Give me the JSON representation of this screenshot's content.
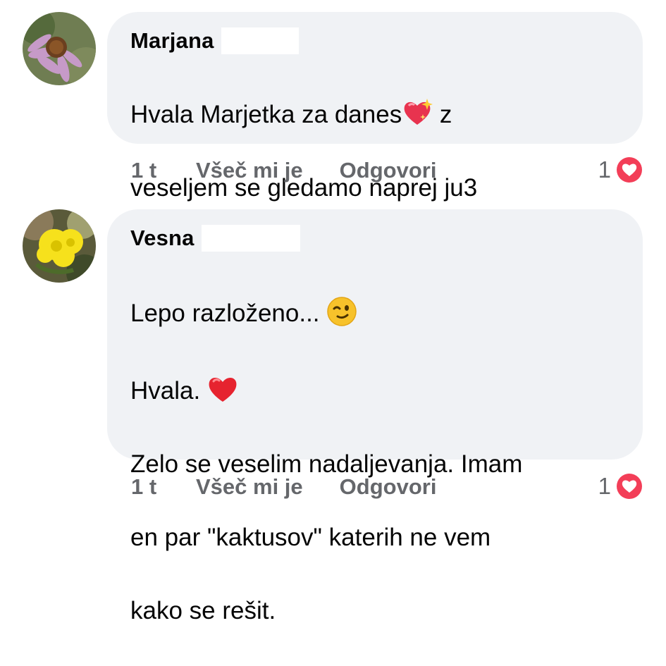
{
  "comments": [
    {
      "author": "Marjana",
      "lines": [
        "Hvala Marjetka za danes",
        " z",
        "veseljem se gledamo naprej ju3"
      ],
      "emoji_1": "sparkling-heart",
      "time": "1 t",
      "like_label": "Všeč mi je",
      "reply_label": "Odgovori",
      "reaction_count": "1",
      "reaction_type": "love"
    },
    {
      "author": "Vesna",
      "lines": [
        "Lepo razloženo... ",
        "Hvala. ",
        "Zelo se veselim nadaljevanja. Imam",
        "en par \"kaktusov\" katerih ne vem",
        "kako se rešit."
      ],
      "emoji_1": "winking-face",
      "emoji_2": "red-heart",
      "time": "1 t",
      "like_label": "Všeč mi je",
      "reply_label": "Odgovori",
      "reaction_count": "1",
      "reaction_type": "love"
    }
  ],
  "colors": {
    "bubble": "#f0f2f5",
    "text": "#050505",
    "secondary": "#65676b",
    "love": "#f33e58"
  }
}
